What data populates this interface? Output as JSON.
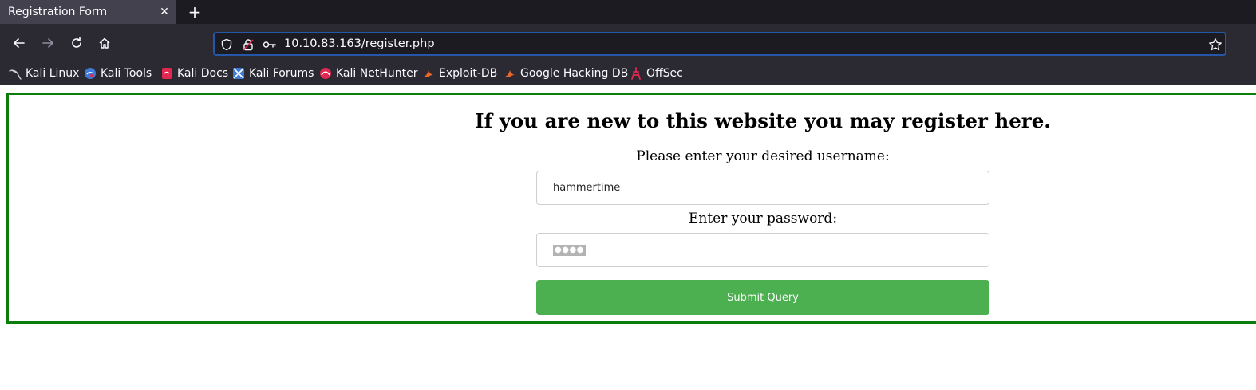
{
  "browser": {
    "tab": {
      "title": "Registration Form",
      "close_glyph": "✕"
    },
    "new_tab_glyph": "+",
    "url": "10.10.83.163/register.php",
    "bookmarks": [
      {
        "label": "Kali Linux",
        "icon": "kali-dragon-icon"
      },
      {
        "label": "Kali Tools",
        "icon": "kali-tools-icon"
      },
      {
        "label": "Kali Docs",
        "icon": "kali-docs-icon"
      },
      {
        "label": "Kali Forums",
        "icon": "kali-forums-icon"
      },
      {
        "label": "Kali NetHunter",
        "icon": "nethunter-icon"
      },
      {
        "label": "Exploit-DB",
        "icon": "exploit-db-icon"
      },
      {
        "label": "Google Hacking DB",
        "icon": "ghdb-icon"
      },
      {
        "label": "OffSec",
        "icon": "offsec-icon"
      }
    ]
  },
  "page": {
    "heading": "If you are new to this website you may register here.",
    "username_label": "Please enter your desired username:",
    "username_value": "hammertime",
    "password_label": "Enter your password:",
    "password_mask": "●●●●",
    "submit_label": "Submit Query",
    "colors": {
      "border": "#0a7d0a",
      "button": "#4caf50"
    }
  }
}
